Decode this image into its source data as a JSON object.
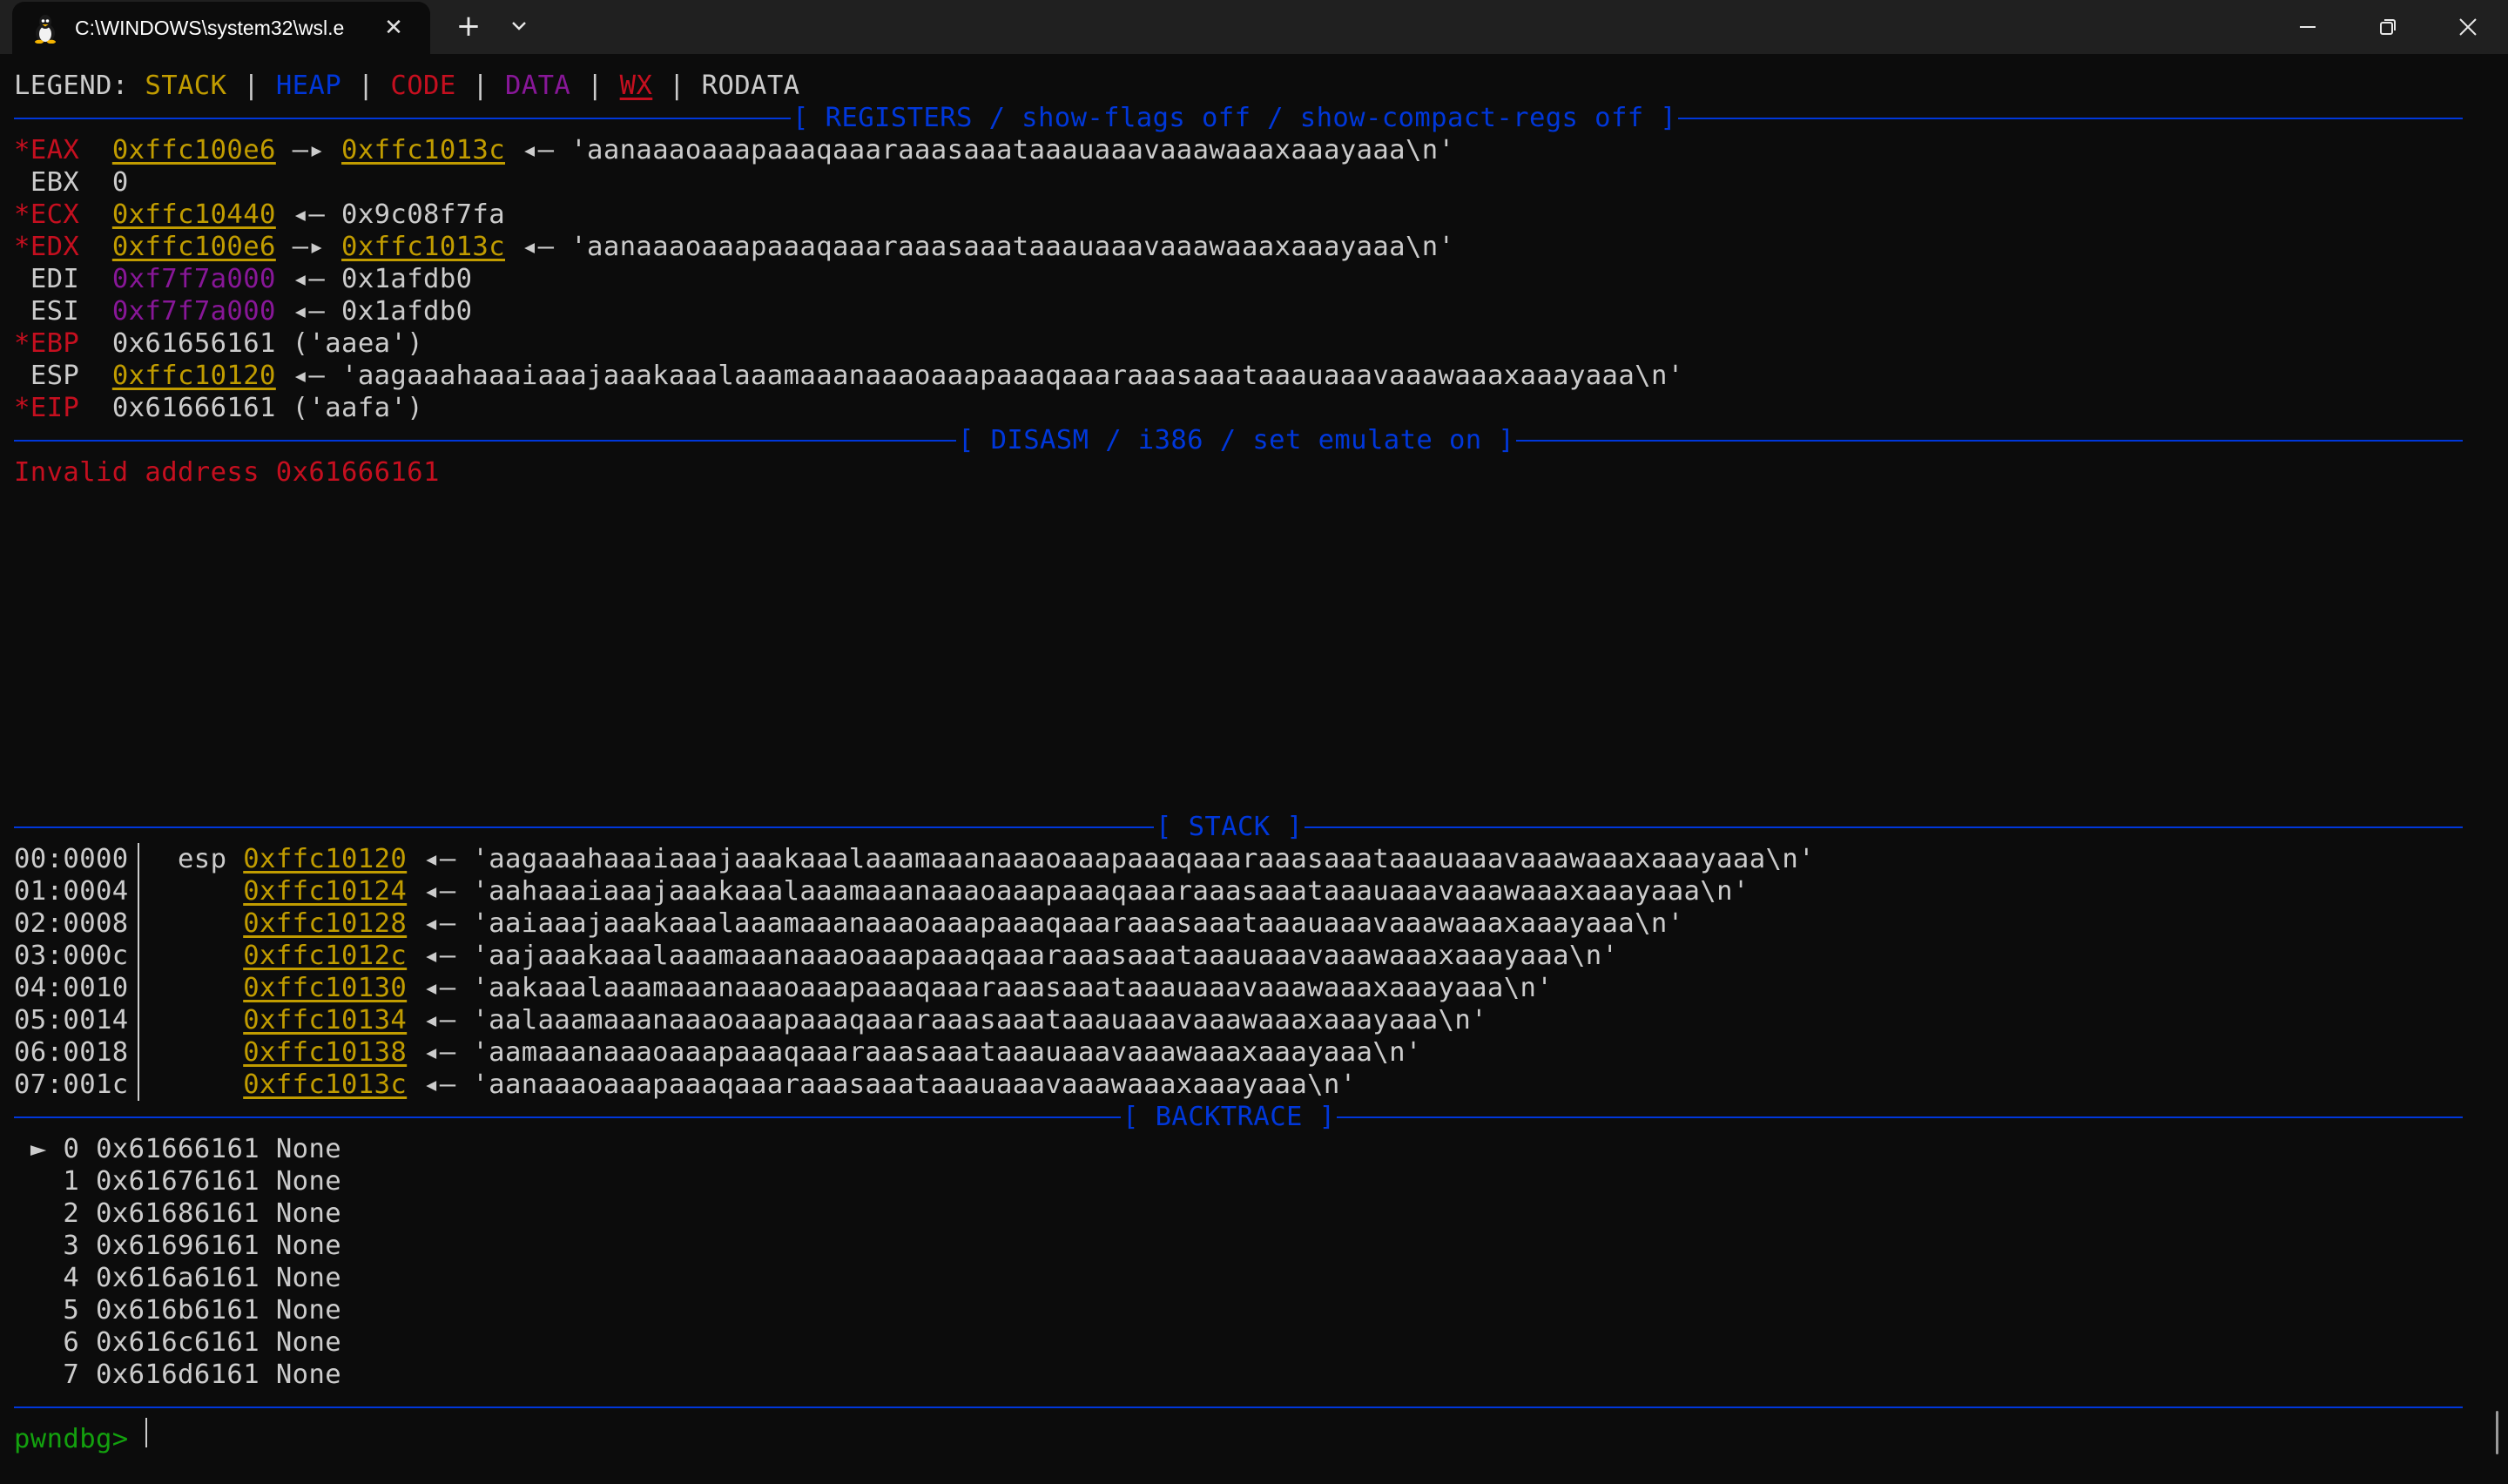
{
  "window": {
    "tab_title": "C:\\WINDOWS\\system32\\wsl.e",
    "tab_close": "✕",
    "new_tab": "+"
  },
  "legend": {
    "label": "LEGEND: ",
    "stack": "STACK",
    "heap": "HEAP",
    "code": "CODE",
    "data": "DATA",
    "wx": "WX",
    "rodata": "RODATA",
    "pipe": " | "
  },
  "headers": {
    "registers": "[ REGISTERS / show-flags off / show-compact-regs off ]",
    "disasm": "[ DISASM / i386 / set emulate on ]",
    "stack": "[ STACK ]",
    "backtrace": "[ BACKTRACE ]"
  },
  "registers": [
    {
      "mark": "*",
      "name": "EAX",
      "addr": "0xffc100e6",
      "arrow": " —▸ ",
      "addr2": "0xffc1013c",
      "rest": " ◂— 'aanaaaoaaapaaaqaaaraaasaaataaauaaavaaawaaaxaaayaaa\\n'"
    },
    {
      "mark": " ",
      "name": "EBX",
      "value": "0"
    },
    {
      "mark": "*",
      "name": "ECX",
      "addr": "0xffc10440",
      "rest": " ◂— 0x9c08f7fa"
    },
    {
      "mark": "*",
      "name": "EDX",
      "addr": "0xffc100e6",
      "arrow": " —▸ ",
      "addr2": "0xffc1013c",
      "rest": " ◂— 'aanaaaoaaapaaaqaaaraaasaaataaauaaavaaawaaaxaaayaaa\\n'"
    },
    {
      "mark": " ",
      "name": "EDI",
      "addr": "0xf7f7a000",
      "rest": " ◂— 0x1afdb0"
    },
    {
      "mark": " ",
      "name": "ESI",
      "addr": "0xf7f7a000",
      "rest": " ◂— 0x1afdb0"
    },
    {
      "mark": "*",
      "name": "EBP",
      "value": "0x61656161 ('aaea')"
    },
    {
      "mark": " ",
      "name": "ESP",
      "addr": "0xffc10120",
      "rest": " ◂— 'aagaaahaaaiaaajaaakaaalaaamaaanaaaoaaapaaaqaaaraaasaaataaauaaavaaawaaaxaaayaaa\\n'"
    },
    {
      "mark": "*",
      "name": "EIP",
      "value": "0x61666161 ('aafa')"
    }
  ],
  "disasm": {
    "error": "Invalid address 0x61666161"
  },
  "stack": [
    {
      "offset": "00:0000",
      "reg": "esp",
      "addr": "0xffc10120",
      "value": " ◂— 'aagaaahaaaiaaajaaakaaalaaamaaanaaaoaaapaaaqaaaraaasaaataaauaaavaaawaaaxaaayaaa\\n'"
    },
    {
      "offset": "01:0004",
      "reg": "",
      "addr": "0xffc10124",
      "value": " ◂— 'aahaaaiaaajaaakaaalaaamaaanaaaoaaapaaaqaaaraaasaaataaauaaavaaawaaaxaaayaaa\\n'"
    },
    {
      "offset": "02:0008",
      "reg": "",
      "addr": "0xffc10128",
      "value": " ◂— 'aaiaaajaaakaaalaaamaaanaaaoaaapaaaqaaaraaasaaataaauaaavaaawaaaxaaayaaa\\n'"
    },
    {
      "offset": "03:000c",
      "reg": "",
      "addr": "0xffc1012c",
      "value": " ◂— 'aajaaakaaalaaamaaanaaaoaaapaaaqaaaraaasaaataaauaaavaaawaaaxaaayaaa\\n'"
    },
    {
      "offset": "04:0010",
      "reg": "",
      "addr": "0xffc10130",
      "value": " ◂— 'aakaaalaaamaaanaaaoaaapaaaqaaaraaasaaataaauaaavaaawaaaxaaayaaa\\n'"
    },
    {
      "offset": "05:0014",
      "reg": "",
      "addr": "0xffc10134",
      "value": " ◂— 'aalaaamaaanaaaoaaapaaaqaaaraaasaaataaauaaavaaawaaaxaaayaaa\\n'"
    },
    {
      "offset": "06:0018",
      "reg": "",
      "addr": "0xffc10138",
      "value": " ◂— 'aamaaanaaaoaaapaaaqaaaraaasaaataaauaaavaaawaaaxaaayaaa\\n'"
    },
    {
      "offset": "07:001c",
      "reg": "",
      "addr": "0xffc1013c",
      "value": " ◂— 'aanaaaoaaapaaaqaaaraaasaaataaauaaavaaawaaaxaaayaaa\\n'"
    }
  ],
  "backtrace": [
    {
      "marker": "►",
      "index": "0",
      "addr": "0x61666161",
      "sym": "None"
    },
    {
      "marker": " ",
      "index": "1",
      "addr": "0x61676161",
      "sym": "None"
    },
    {
      "marker": " ",
      "index": "2",
      "addr": "0x61686161",
      "sym": "None"
    },
    {
      "marker": " ",
      "index": "3",
      "addr": "0x61696161",
      "sym": "None"
    },
    {
      "marker": " ",
      "index": "4",
      "addr": "0x616a6161",
      "sym": "None"
    },
    {
      "marker": " ",
      "index": "5",
      "addr": "0x616b6161",
      "sym": "None"
    },
    {
      "marker": " ",
      "index": "6",
      "addr": "0x616c6161",
      "sym": "None"
    },
    {
      "marker": " ",
      "index": "7",
      "addr": "0x616d6161",
      "sym": "None"
    }
  ],
  "prompt": "pwndbg> ",
  "colors": {
    "stack": "#c19c00",
    "heap": "#0037da",
    "code": "#c50f1f",
    "data": "#881798",
    "wx": "#c50f1f",
    "prompt": "#13a10e"
  }
}
